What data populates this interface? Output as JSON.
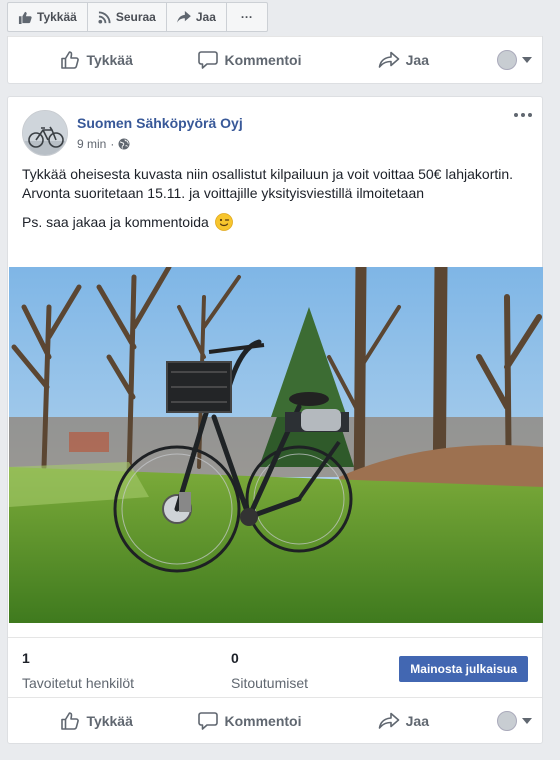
{
  "page_bar": {
    "like_label": "Tykkää",
    "follow_label": "Seuraa",
    "share_label": "Jaa",
    "more_label": "···"
  },
  "prev_post": {
    "actions": {
      "like": "Tykkää",
      "comment": "Kommentoi",
      "share": "Jaa"
    }
  },
  "post": {
    "page_name": "Suomen Sähköpyörä Oyj",
    "time": "9 min",
    "dot": "·",
    "privacy_icon": "globe-icon",
    "paragraph1": "Tykkää oheisesta kuvasta niin osallistut kilpailuun ja voit voittaa 50€ lahjakortin. Arvonta suoritetaan 15.11. ja voittajille yksityisviestillä ilmoitetaan",
    "paragraph2": "Ps. saa jakaa ja kommentoida",
    "emoji": "winking-face-icon",
    "image": "electric city bicycle with front basket standing on grass among trees",
    "stats": {
      "reach_value": "1",
      "reach_label": "Tavoitetut henkilöt",
      "engagement_value": "0",
      "engagement_label": "Sitoutumiset"
    },
    "boost_label": "Mainosta julkaisua",
    "actions": {
      "like": "Tykkää",
      "comment": "Kommentoi",
      "share": "Jaa"
    }
  },
  "colors": {
    "link_blue": "#385898",
    "button_blue": "#4267b2",
    "background": "#e9ebee"
  }
}
